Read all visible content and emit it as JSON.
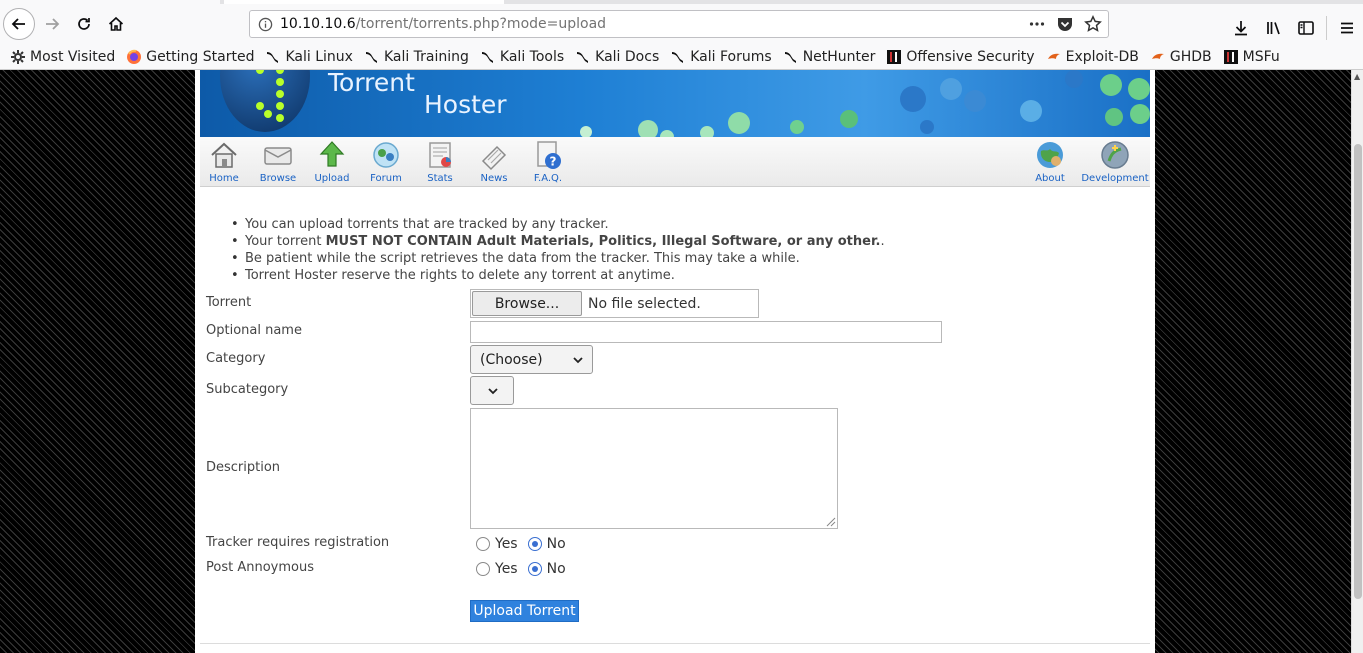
{
  "browser": {
    "url_host": "10.10.10.6",
    "url_path": "/torrent/torrents.php?mode=upload",
    "bookmarks": [
      {
        "label": "Most Visited",
        "icon": "gear-icon"
      },
      {
        "label": "Getting Started",
        "icon": "firefox-icon"
      },
      {
        "label": "Kali Linux",
        "icon": "kali-dragon-icon"
      },
      {
        "label": "Kali Training",
        "icon": "kali-dragon-icon"
      },
      {
        "label": "Kali Tools",
        "icon": "kali-dragon-icon"
      },
      {
        "label": "Kali Docs",
        "icon": "kali-dragon-icon"
      },
      {
        "label": "Kali Forums",
        "icon": "kali-dragon-icon"
      },
      {
        "label": "NetHunter",
        "icon": "kali-dragon-icon"
      },
      {
        "label": "Offensive Security",
        "icon": "offsec-icon"
      },
      {
        "label": "Exploit-DB",
        "icon": "exploitdb-icon"
      },
      {
        "label": "GHDB",
        "icon": "exploitdb-icon"
      },
      {
        "label": "MSFu",
        "icon": "offsec-icon"
      }
    ]
  },
  "site": {
    "title_line1": "Torrent",
    "title_line2": "Hoster",
    "menu": [
      {
        "label": "Home",
        "icon": "home-icon"
      },
      {
        "label": "Browse",
        "icon": "browse-icon"
      },
      {
        "label": "Upload",
        "icon": "upload-icon"
      },
      {
        "label": "Forum",
        "icon": "forum-icon"
      },
      {
        "label": "Stats",
        "icon": "stats-icon"
      },
      {
        "label": "News",
        "icon": "news-icon"
      },
      {
        "label": "F.A.Q.",
        "icon": "faq-icon"
      }
    ],
    "menu_right": [
      {
        "label": "About",
        "icon": "about-icon"
      },
      {
        "label": "Development",
        "icon": "development-icon"
      }
    ]
  },
  "rules": {
    "r1": "You can upload torrents that are tracked by any tracker.",
    "r2_pre": "Your torrent ",
    "r2_bold": "MUST NOT CONTAIN Adult Materials, Politics, Illegal Software, or any other.",
    "r2_post": ".",
    "r3": "Be patient while the script retrieves the data from the tracker. This may take a while.",
    "r4": "Torrent Hoster reserve the rights to delete any torrent at anytime."
  },
  "form": {
    "torrent_label": "Torrent",
    "browse_label": "Browse...",
    "file_status": "No file selected.",
    "optional_name_label": "Optional name",
    "optional_name_value": "",
    "category_label": "Category",
    "category_value": "(Choose)",
    "subcategory_label": "Subcategory",
    "subcategory_value": "",
    "description_label": "Description",
    "description_value": "",
    "tracker_reg_label": "Tracker requires registration",
    "post_anon_label": "Post Annoymous",
    "yes_label": "Yes",
    "no_label": "No",
    "tracker_reg_selected": "No",
    "post_anon_selected": "No",
    "submit_label": "Upload Torrent"
  }
}
